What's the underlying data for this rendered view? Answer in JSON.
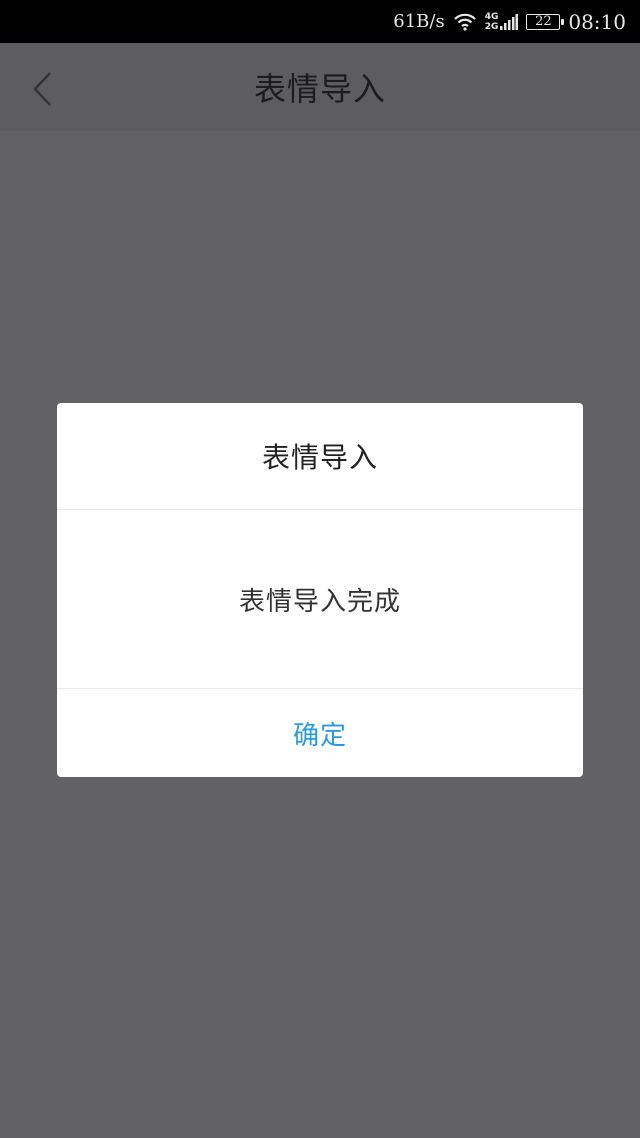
{
  "status_bar": {
    "net_speed": "61B/s",
    "network_top": "4G",
    "network_bottom": "2G",
    "battery": "22",
    "time": "08:10"
  },
  "header": {
    "title": "表情导入",
    "back_icon": "chevron-left-icon"
  },
  "dialog": {
    "title": "表情导入",
    "message": "表情导入完成",
    "confirm_label": "确定"
  },
  "colors": {
    "accent": "#2a9be3",
    "overlay": "#626265",
    "status_bar": "#000000"
  }
}
